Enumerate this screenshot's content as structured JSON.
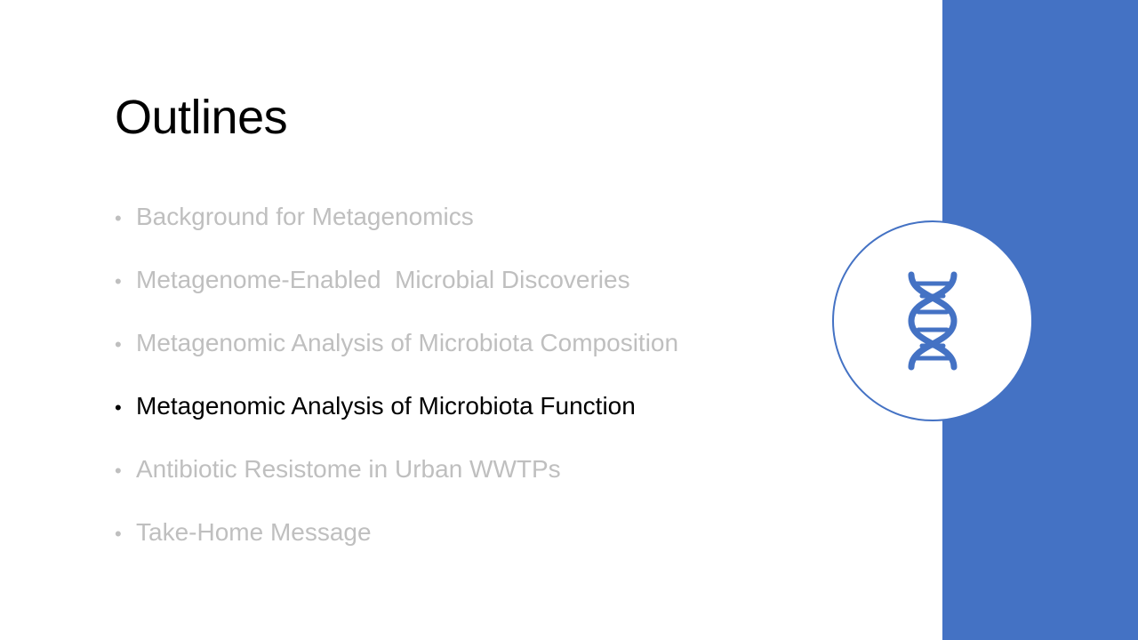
{
  "slide": {
    "title": "Outlines",
    "active_index": 3,
    "items": [
      {
        "label": "Background for Metagenomics",
        "active": false
      },
      {
        "label": "Metagenome-Enabled  Microbial Discoveries",
        "active": false
      },
      {
        "label": "Metagenomic Analysis of Microbiota Composition",
        "active": false
      },
      {
        "label": "Metagenomic Analysis of Microbiota Function",
        "active": true
      },
      {
        "label": "Antibiotic Resistome in Urban WWTPs",
        "active": false
      },
      {
        "label": "Take-Home Message",
        "active": false
      }
    ],
    "bullet_char": "•",
    "icon": "dna-icon"
  },
  "colors": {
    "accent": "#4472c4",
    "inactive_text": "#bfbfbf",
    "active_text": "#000000",
    "background": "#ffffff"
  }
}
